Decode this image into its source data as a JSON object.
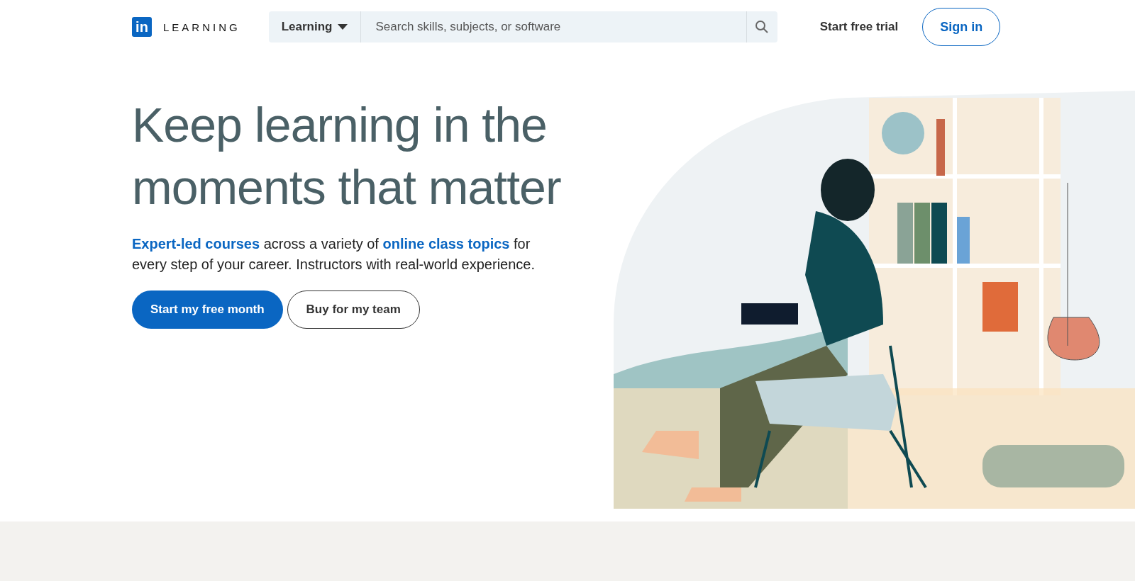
{
  "header": {
    "logo_mark": "in",
    "logo_text": "LEARNING",
    "category_dropdown": "Learning",
    "search": {
      "placeholder": "Search skills, subjects, or software"
    },
    "start_trial": "Start free trial",
    "sign_in": "Sign in"
  },
  "hero": {
    "title_lines": [
      "Keep learning in the",
      "moments that matter"
    ],
    "description": [
      {
        "text": "Expert-led courses",
        "link": true
      },
      {
        "text": " across a variety of ",
        "link": false
      },
      {
        "text": "online class topics",
        "link": true
      },
      {
        "text": " for every step of your career. Instructors with real-world experience.",
        "link": false
      }
    ],
    "buttons": [
      {
        "label": "Start my free month",
        "kind": "primary"
      },
      {
        "label": "Buy for my team",
        "kind": "secondary"
      }
    ]
  }
}
